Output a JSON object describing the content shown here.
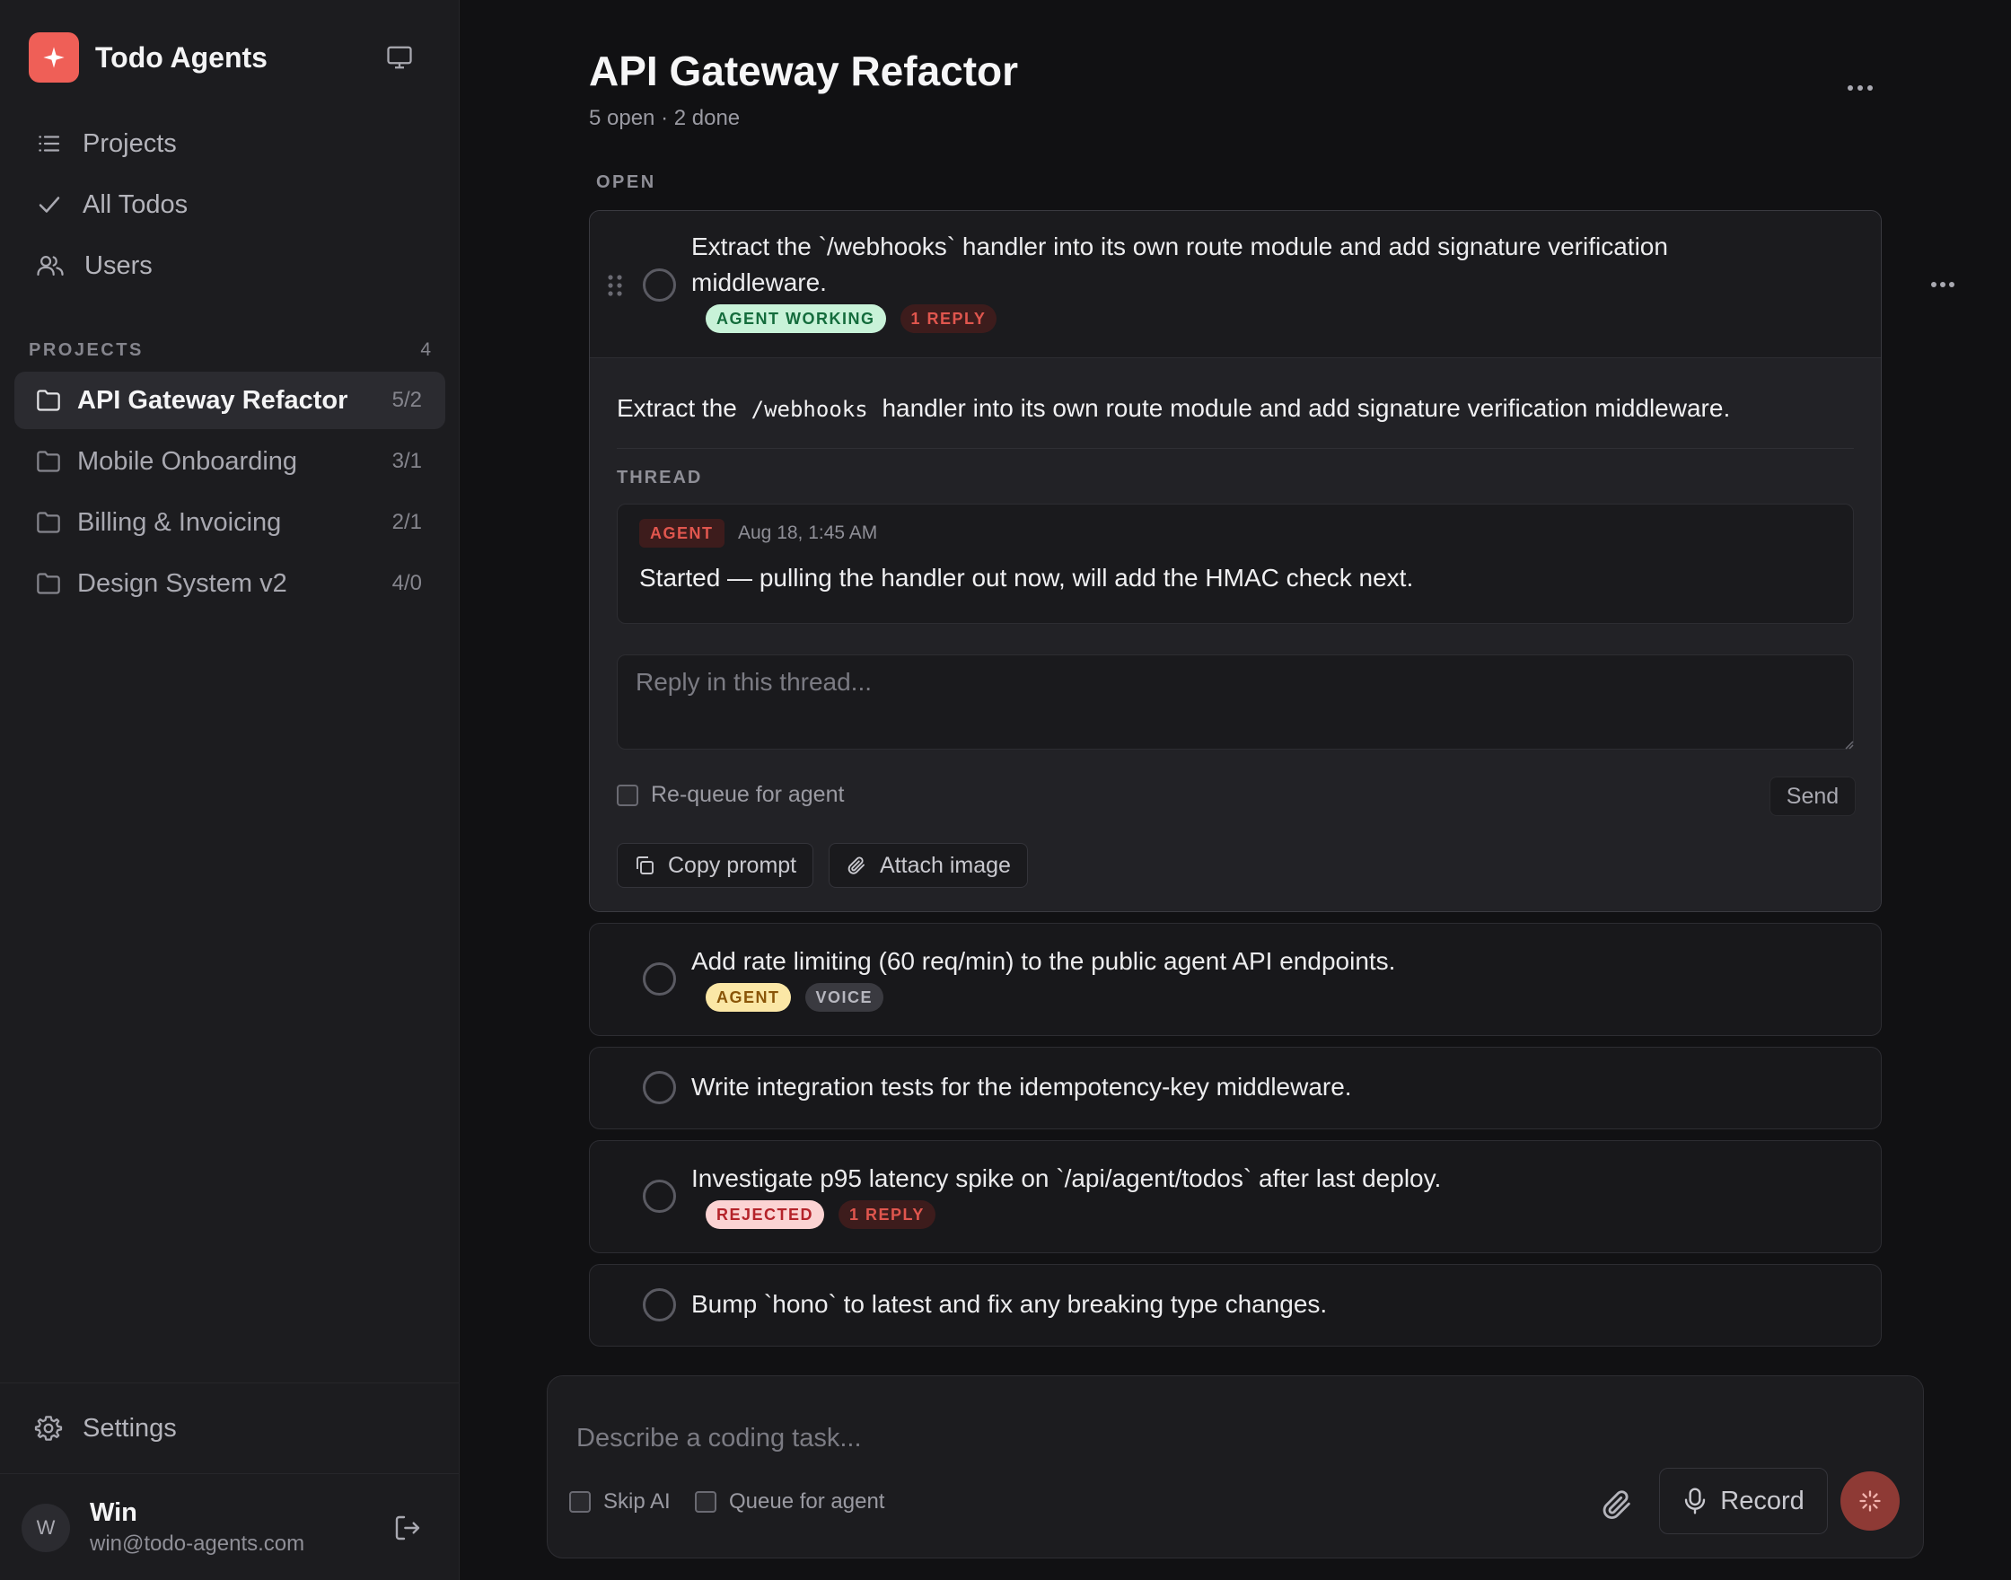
{
  "app": {
    "name": "Todo Agents"
  },
  "colors": {
    "accent": "#ef5f57",
    "background": "#111113",
    "sidebar": "#1c1c1f"
  },
  "sidebar": {
    "nav": [
      {
        "label": "Projects",
        "icon": "list-icon"
      },
      {
        "label": "All Todos",
        "icon": "check-icon"
      },
      {
        "label": "Users",
        "icon": "users-icon"
      }
    ],
    "projects_header": {
      "label": "PROJECTS",
      "count": "4"
    },
    "projects": [
      {
        "name": "API Gateway Refactor",
        "count": "5/2",
        "active": true
      },
      {
        "name": "Mobile Onboarding",
        "count": "3/1"
      },
      {
        "name": "Billing & Invoicing",
        "count": "2/1"
      },
      {
        "name": "Design System v2",
        "count": "4/0"
      }
    ],
    "settings_label": "Settings",
    "user": {
      "initial": "W",
      "name": "Win",
      "email": "win@todo-agents.com"
    }
  },
  "page": {
    "title": "API Gateway Refactor",
    "subtitle": "5 open · 2 done",
    "section_label": "OPEN"
  },
  "todos": [
    {
      "text": "Extract the `/webhooks` handler into its own route module and add signature verification middleware.",
      "badges": [
        "AGENT WORKING",
        "1 REPLY"
      ],
      "expanded": {
        "desc_before": "Extract the",
        "desc_code": "/webhooks",
        "desc_after": "handler into its own route module and add signature verification middleware.",
        "thread_label": "THREAD",
        "message": {
          "author": "AGENT",
          "time": "Aug 18, 1:45 AM",
          "text": "Started — pulling the handler out now, will add the HMAC check next."
        },
        "reply_placeholder": "Reply in this thread...",
        "requeue_label": "Re-queue for agent",
        "send_label": "Send",
        "copy_label": "Copy prompt",
        "attach_label": "Attach image"
      }
    },
    {
      "text": "Add rate limiting (60 req/min) to the public agent API endpoints.",
      "badges": [
        "AGENT",
        "VOICE"
      ]
    },
    {
      "text": "Write integration tests for the idempotency-key middleware.",
      "badges": []
    },
    {
      "text": "Investigate p95 latency spike on `/api/agent/todos` after last deploy.",
      "badges": [
        "REJECTED",
        "1 REPLY"
      ]
    },
    {
      "text": "Bump `hono` to latest and fix any breaking type changes.",
      "badges": []
    }
  ],
  "composer": {
    "placeholder": "Describe a coding task...",
    "skip_ai_label": "Skip AI",
    "queue_label": "Queue for agent",
    "record_label": "Record"
  }
}
